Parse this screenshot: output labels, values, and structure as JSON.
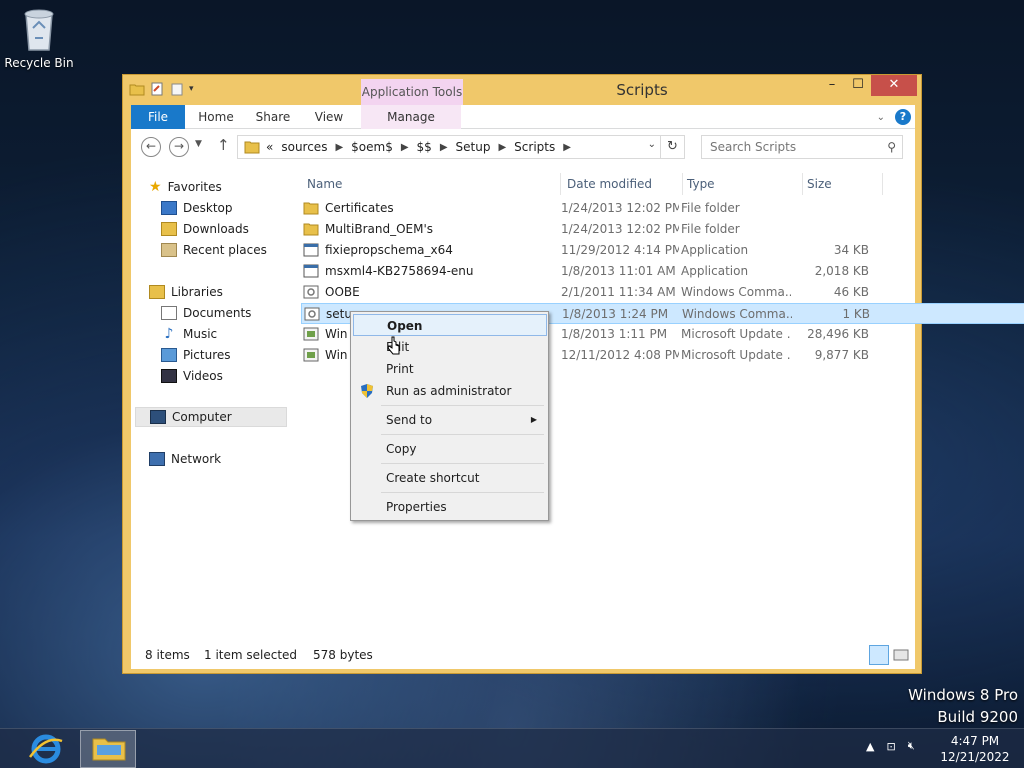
{
  "desktop": {
    "recycle_bin_label": "Recycle Bin",
    "brand_line1": "Windows 8 Pro",
    "brand_line2": "Build 9200"
  },
  "window": {
    "title": "Scripts",
    "context_tab_title": "Application Tools",
    "min": "–",
    "max": "☐",
    "close": "✕"
  },
  "ribbon": {
    "tabs": [
      "File",
      "Home",
      "Share",
      "View",
      "Manage"
    ]
  },
  "address": {
    "overflow": "«",
    "crumbs": [
      "sources",
      "$oem$",
      "$$",
      "Setup",
      "Scripts"
    ],
    "search_placeholder": "Search Scripts"
  },
  "nav_pane": {
    "favorites": "Favorites",
    "favorites_items": [
      "Desktop",
      "Downloads",
      "Recent places"
    ],
    "libraries": "Libraries",
    "libraries_items": [
      "Documents",
      "Music",
      "Pictures",
      "Videos"
    ],
    "computer": "Computer",
    "network": "Network"
  },
  "columns": {
    "name": "Name",
    "date": "Date modified",
    "type": "Type",
    "size": "Size"
  },
  "files": [
    {
      "name": "Certificates",
      "date": "1/24/2013 12:02 PM",
      "type": "File folder",
      "size": "",
      "icon": "folder-icon"
    },
    {
      "name": "MultiBrand_OEM's",
      "date": "1/24/2013 12:02 PM",
      "type": "File folder",
      "size": "",
      "icon": "folder-icon"
    },
    {
      "name": "fixiepropschema_x64",
      "date": "11/29/2012 4:14 PM",
      "type": "Application",
      "size": "34 KB",
      "icon": "application-icon"
    },
    {
      "name": "msxml4-KB2758694-enu",
      "date": "1/8/2013 11:01 AM",
      "type": "Application",
      "size": "2,018 KB",
      "icon": "application-icon"
    },
    {
      "name": "OOBE",
      "date": "2/1/2011 11:34 AM",
      "type": "Windows Comma...",
      "size": "46 KB",
      "icon": "script-icon"
    },
    {
      "name": "setu",
      "date": "1/8/2013 1:24 PM",
      "type": "Windows Comma...",
      "size": "1 KB",
      "icon": "script-icon"
    },
    {
      "name": "Win",
      "date": "1/8/2013 1:11 PM",
      "type": "Microsoft Update ...",
      "size": "28,496 KB",
      "icon": "update-package-icon"
    },
    {
      "name": "Win",
      "date": "12/11/2012 4:08 PM",
      "type": "Microsoft Update ...",
      "size": "9,877 KB",
      "icon": "update-package-icon"
    }
  ],
  "status": {
    "items": "8 items",
    "selection": "1 item selected",
    "bytes": "578 bytes"
  },
  "context_menu": {
    "open": "Open",
    "edit": "Edit",
    "print": "Print",
    "run_as_admin": "Run as administrator",
    "send_to": "Send to",
    "copy": "Copy",
    "create_shortcut": "Create shortcut",
    "properties": "Properties"
  },
  "taskbar": {
    "time": "4:47 PM",
    "date": "12/21/2022"
  }
}
